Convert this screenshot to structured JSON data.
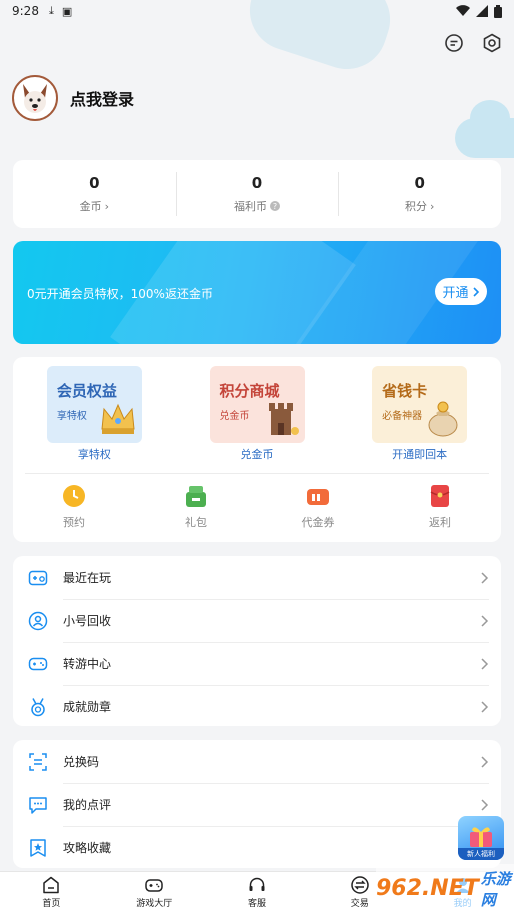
{
  "status_bar": {
    "time": "9:28"
  },
  "header": {
    "login_text": "点我登录"
  },
  "stats": [
    {
      "value": "0",
      "label": "金币",
      "suffix": "›"
    },
    {
      "value": "0",
      "label": "福利币",
      "suffix": "?"
    },
    {
      "value": "0",
      "label": "积分",
      "suffix": "›"
    }
  ],
  "vip": {
    "text": "0元开通会员特权，100%返还金币",
    "button": "开通"
  },
  "tiles": [
    {
      "title": "会员权益",
      "sub": "享特权",
      "caption": "享特权"
    },
    {
      "title": "积分商城",
      "sub": "兑金币",
      "caption": "兑金币"
    },
    {
      "title": "省钱卡",
      "sub": "必备神器",
      "caption": "开通即回本"
    }
  ],
  "mini_items": [
    {
      "label": "预约",
      "color": "#f7b625"
    },
    {
      "label": "礼包",
      "color": "#4caf50"
    },
    {
      "label": "代金券",
      "color": "#f26b3a"
    },
    {
      "label": "返利",
      "color": "#e84545"
    }
  ],
  "list_group_1": [
    {
      "label": "最近在玩",
      "icon": "gamepad-clock-icon"
    },
    {
      "label": "小号回收",
      "icon": "user-recycle-icon"
    },
    {
      "label": "转游中心",
      "icon": "game-transfer-icon"
    },
    {
      "label": "成就勋章",
      "icon": "medal-icon"
    }
  ],
  "list_group_2": [
    {
      "label": "兑换码",
      "icon": "scan-code-icon"
    },
    {
      "label": "我的点评",
      "icon": "comment-icon"
    },
    {
      "label": "攻略收藏",
      "icon": "star-bookmark-icon"
    }
  ],
  "float_badge": {
    "label": "新人福利"
  },
  "bottom_nav": [
    {
      "label": "首页"
    },
    {
      "label": "游戏大厅"
    },
    {
      "label": "客服"
    },
    {
      "label": "交易"
    },
    {
      "label": "我的"
    }
  ],
  "watermark": {
    "main": "962.NET",
    "sub": "乐游网"
  },
  "colors": {
    "accent": "#1a8ef0",
    "page_bg": "#f3f4f6"
  }
}
